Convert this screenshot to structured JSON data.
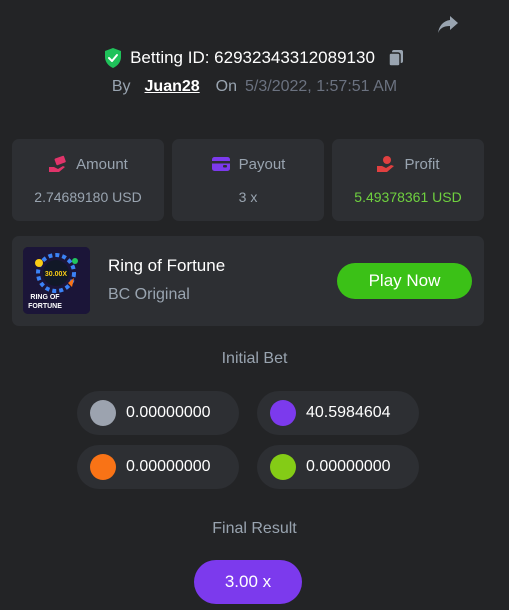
{
  "header": {
    "share_icon": "share-arrow-icon",
    "verified_icon": "shield-check-icon",
    "betting_id_label": "Betting ID: 62932343312089130",
    "copy_icon": "copy-icon",
    "by_label": "By",
    "username": "Juan28",
    "on_label": "On",
    "timestamp": "5/3/2022, 1:57:51 AM"
  },
  "stats": [
    {
      "label": "Amount",
      "value": "2.74689180 USD",
      "icon": "hand-money-icon",
      "icon_color": "#e0346a"
    },
    {
      "label": "Payout",
      "value": "3 x",
      "icon": "wallet-icon",
      "icon_color": "#7c3aed"
    },
    {
      "label": "Profit",
      "value": "5.49378361 USD",
      "icon": "hand-coin-icon",
      "icon_color": "#e04040",
      "value_color": "#6fd13f"
    }
  ],
  "game": {
    "thumbnail_icon": "ring-of-fortune-thumbnail",
    "thumbnail_text_top": "30.00X",
    "thumbnail_text_line1": "RING OF",
    "thumbnail_text_line2": "FORTUNE",
    "title": "Ring of Fortune",
    "subtitle": "BC Original",
    "play_label": "Play Now"
  },
  "initial_bet": {
    "title": "Initial Bet",
    "coins": [
      {
        "value": "0.00000000",
        "color": "#9ca3af"
      },
      {
        "value": "40.5984604",
        "color": "#7c3aed"
      },
      {
        "value": "0.00000000",
        "color": "#f97316"
      },
      {
        "value": "0.00000000",
        "color": "#84cc16"
      }
    ]
  },
  "final_result": {
    "title": "Final Result",
    "value": "3.00 x",
    "accent": "#7c3aed"
  },
  "colors": {
    "background": "#232426",
    "card": "#2d2f33",
    "accent_green": "#3bc117",
    "muted_text": "#99a4b0"
  }
}
